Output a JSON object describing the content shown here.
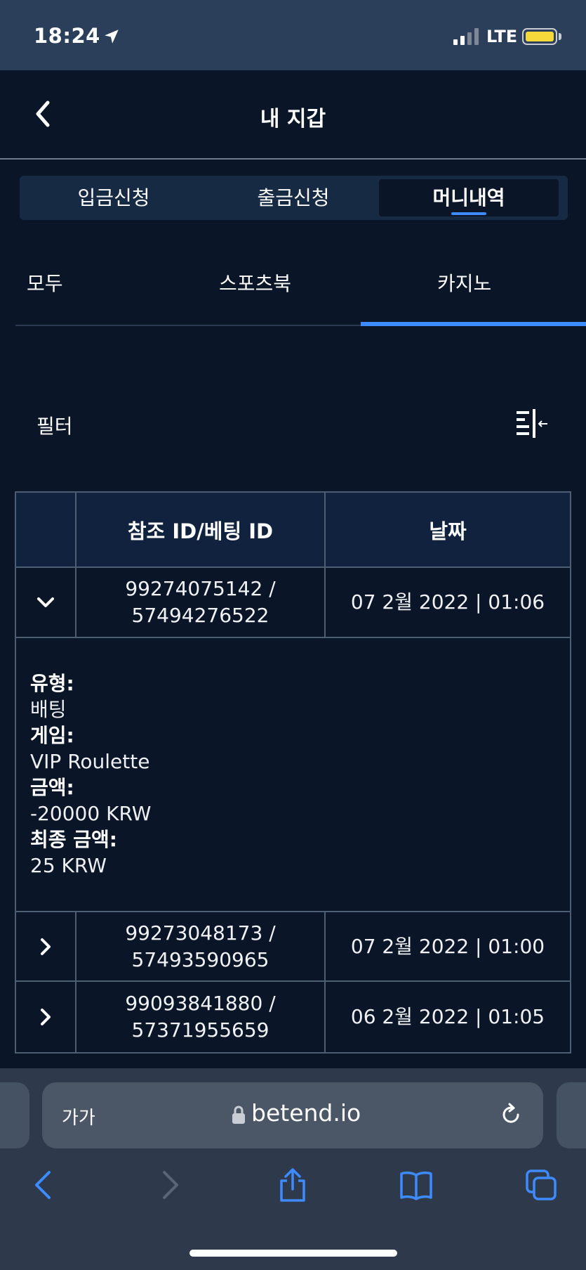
{
  "status": {
    "time": "18:24",
    "network": "LTE"
  },
  "header": {
    "title": "내 지갑"
  },
  "segments": [
    {
      "label": "입금신청"
    },
    {
      "label": "출금신청"
    },
    {
      "label": "머니내역"
    }
  ],
  "subtabs": [
    {
      "label": "모두"
    },
    {
      "label": "스포츠북"
    },
    {
      "label": "카지노"
    }
  ],
  "filter": {
    "label": "필터"
  },
  "table": {
    "headers": [
      "",
      "참조 ID/베팅 ID",
      "날짜"
    ],
    "rows": [
      {
        "ids_line1": "99274075142 /",
        "ids_line2": "57494276522",
        "date": "07 2월 2022 | 01:06",
        "expanded": true
      },
      {
        "ids_line1": "99273048173 /",
        "ids_line2": "57493590965",
        "date": "07 2월 2022 | 01:00",
        "expanded": false
      },
      {
        "ids_line1": "99093841880 /",
        "ids_line2": "57371955659",
        "date": "06 2월 2022 | 01:05",
        "expanded": false
      }
    ],
    "details": {
      "type_label": "유형:",
      "type_value": "배팅",
      "game_label": "게임:",
      "game_value": "VIP Roulette",
      "amount_label": "금액:",
      "amount_value": "-20000 KRW",
      "final_label": "최종 금액:",
      "final_value": "25 KRW"
    }
  },
  "browser": {
    "text_size": "가가",
    "url": "betend.io"
  },
  "colors": {
    "accent": "#3d8bff",
    "background": "#0a1628",
    "statusbar": "#2b3f5a"
  }
}
